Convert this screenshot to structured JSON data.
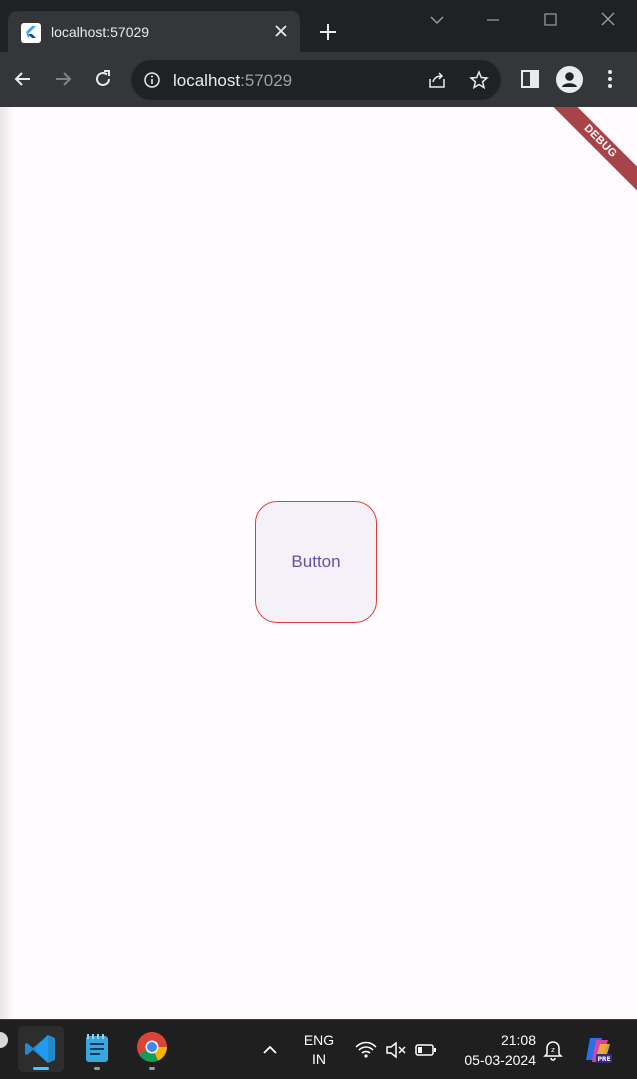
{
  "browser": {
    "tab_title": "localhost:57029",
    "url_host": "localhost",
    "url_port": ":57029"
  },
  "page": {
    "debug_banner": "DEBUG",
    "button_label": "Button"
  },
  "taskbar": {
    "language_line1": "ENG",
    "language_line2": "IN",
    "time": "21:08",
    "date": "05-03-2024"
  },
  "colors": {
    "page_background": "#fffbfe",
    "button_border": "#e53935",
    "button_text": "#6750a4",
    "debug_banner": "#a8434a"
  }
}
